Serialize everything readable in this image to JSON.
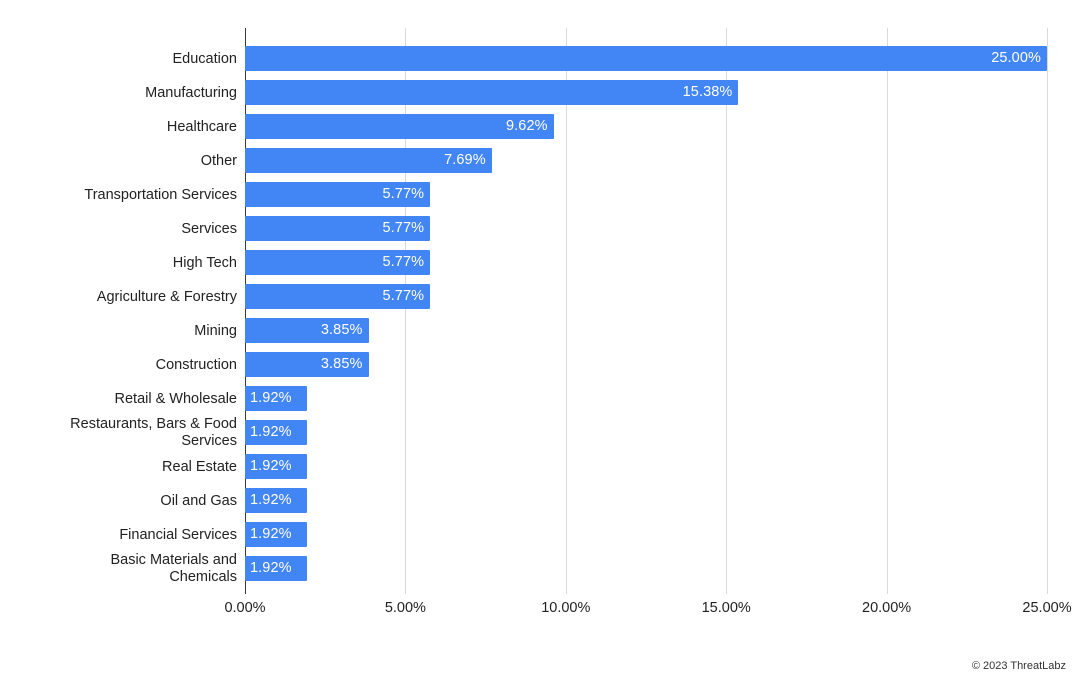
{
  "chart_data": {
    "type": "bar",
    "orientation": "horizontal",
    "title": "",
    "subtitle": "",
    "xlabel": "",
    "ylabel": "",
    "xlim": [
      0,
      25
    ],
    "grid": true,
    "legend": false,
    "legend_position": "none",
    "bar_color": "#4285f4",
    "axis_color": "#3a3a3a",
    "gridline_color": "#d9d9d9",
    "value_label_color": "#ffffff",
    "x_ticks": [
      "0.00%",
      "5.00%",
      "10.00%",
      "15.00%",
      "20.00%",
      "25.00%"
    ],
    "x_tick_values": [
      0,
      5,
      10,
      15,
      20,
      25
    ],
    "categories": [
      "Education",
      "Manufacturing",
      "Healthcare",
      "Other",
      "Transportation Services",
      "Services",
      "High Tech",
      "Agriculture & Forestry",
      "Mining",
      "Construction",
      "Retail & Wholesale",
      "Restaurants, Bars & Food\nServices",
      "Real Estate",
      "Oil and Gas",
      "Financial Services",
      "Basic Materials and\nChemicals"
    ],
    "values": [
      25.0,
      15.38,
      9.62,
      7.69,
      5.77,
      5.77,
      5.77,
      5.77,
      3.85,
      3.85,
      1.92,
      1.92,
      1.92,
      1.92,
      1.92,
      1.92
    ],
    "value_labels": [
      "25.00%",
      "15.38%",
      "9.62%",
      "7.69%",
      "5.77%",
      "5.77%",
      "5.77%",
      "5.77%",
      "3.85%",
      "3.85%",
      "1.92%",
      "1.92%",
      "1.92%",
      "1.92%",
      "1.92%",
      "1.92%"
    ]
  },
  "footer": {
    "credit": "© 2023 ThreatLabz"
  }
}
